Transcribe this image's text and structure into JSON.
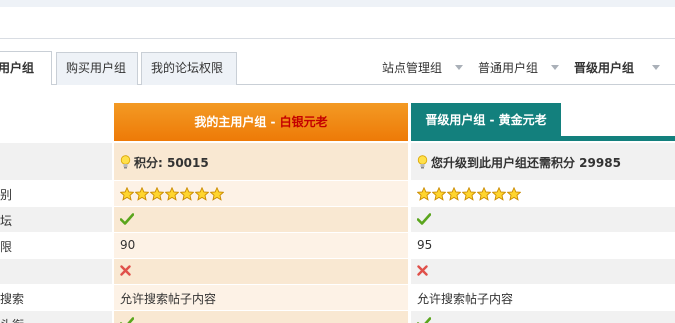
{
  "tabs": [
    {
      "label": "用户组",
      "active": true
    },
    {
      "label": "购买用户组",
      "active": false
    },
    {
      "label": "我的论坛权限",
      "active": false
    }
  ],
  "right_nav": [
    {
      "label": "站点管理组",
      "bold": false
    },
    {
      "label": "普通用户组",
      "bold": false
    },
    {
      "label": "晋级用户组",
      "bold": true
    }
  ],
  "columns": {
    "main": {
      "prefix": "我的主用户组 - ",
      "group": "白银元老"
    },
    "upgrade": {
      "title": "晋级用户组 - 黄金元老"
    }
  },
  "rows": [
    {
      "label": "",
      "main": "积分: 50015",
      "upgrade": "您升级到此用户组还需积分 29985",
      "type": "points"
    },
    {
      "label": "别",
      "main_stars": 7,
      "upgrade_stars": 7,
      "type": "stars"
    },
    {
      "label": "坛",
      "main": "check",
      "upgrade": "check",
      "type": "icon"
    },
    {
      "label": "限",
      "main": "90",
      "upgrade": "95",
      "type": "text"
    },
    {
      "label": "",
      "main": "cross",
      "upgrade": "cross",
      "type": "icon"
    },
    {
      "label": "搜索",
      "main": "允许搜索帖子内容",
      "upgrade": "允许搜索帖子内容",
      "type": "text"
    },
    {
      "label": "头衔",
      "main": "check",
      "upgrade": "check",
      "type": "icon"
    }
  ],
  "colors": {
    "accent_orange": "#ee7a07",
    "accent_teal": "#13807d",
    "group_name_red": "#c40000"
  },
  "icons": [
    "bulb-icon",
    "star-icon",
    "check-icon",
    "cross-icon",
    "caret-down-icon"
  ]
}
